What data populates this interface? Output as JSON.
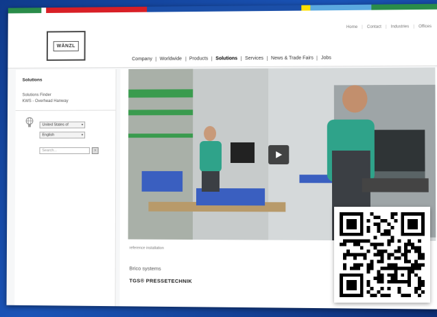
{
  "colors": {
    "topbar": [
      "#2a8c4a",
      "#ffffff",
      "#d81f26",
      "#1b4fa8",
      "#ffe000",
      "#5ba9e0",
      "#2a8c4a"
    ],
    "accent": "#2a8c4a",
    "play_button": "#282828"
  },
  "logo": {
    "text": "WÄNZL"
  },
  "utility_nav": [
    "Home",
    "Contact",
    "Industries",
    "Offices"
  ],
  "main_nav": {
    "items": [
      "Company",
      "Worldwide",
      "Products",
      "Solutions",
      "Services",
      "News & Trade Fairs",
      "Jobs"
    ],
    "active": "Solutions"
  },
  "sidebar": {
    "title": "Solutions",
    "subtitle_lines": [
      "Solutions Finder",
      "KWS - Overhead Hanway"
    ],
    "country": "United States of",
    "language": "English",
    "search_placeholder": "Search...",
    "search_go": "›"
  },
  "content": {
    "caption": "reference installation",
    "title": "Brico systems",
    "brand": "TGS® PRESSETECHNIK"
  },
  "icons": {
    "globe": "globe-icon",
    "play": "play-icon",
    "qr": "qr-code"
  }
}
